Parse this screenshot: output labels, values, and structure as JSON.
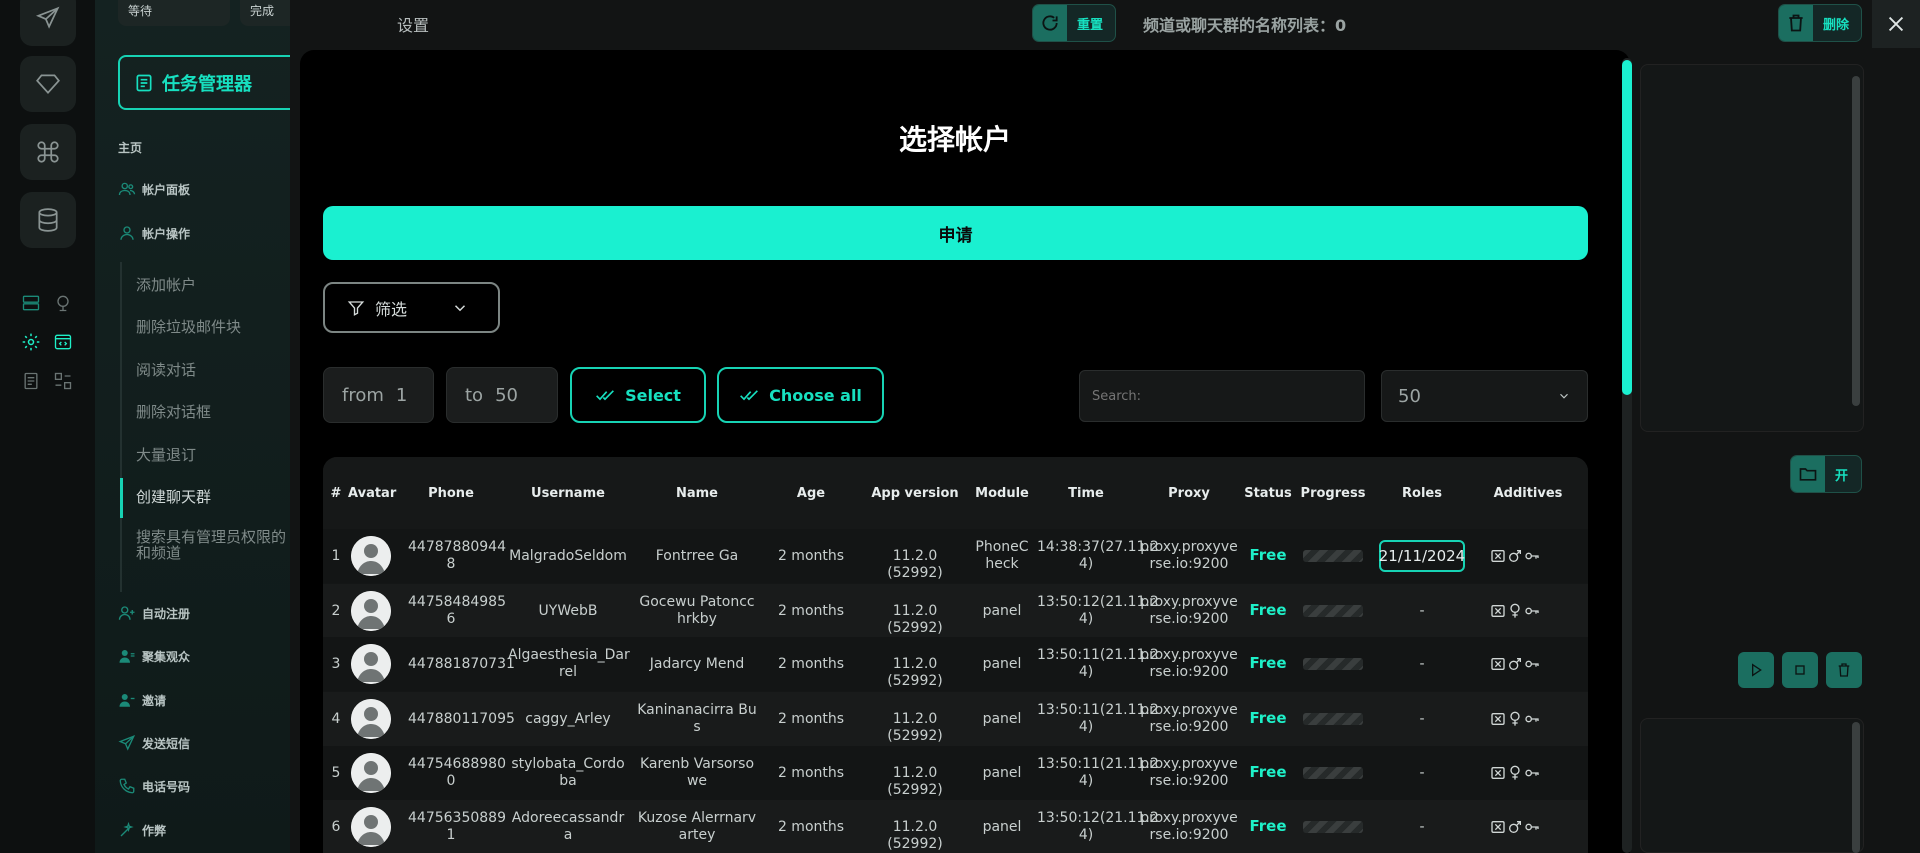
{
  "sidebar_top": {
    "waiting": "等待",
    "done": "完成"
  },
  "sidebar": {
    "task_manager": "任务管理器",
    "home": "主页",
    "account_panel": "帐户面板",
    "account_ops": "帐户操作",
    "sub_items": [
      "添加帐户",
      "删除垃圾邮件块",
      "阅读对话",
      "删除对话框",
      "大量退订",
      "创建聊天群",
      "搜索具有管理员权限的和频道"
    ],
    "sections": [
      "自动注册",
      "聚集观众",
      "邀请",
      "发送短信",
      "电话号码",
      "作弊"
    ]
  },
  "topbar": {
    "settings": "设置",
    "reset": "重置",
    "channel_count": "频道或聊天群的名称列表：0",
    "delete": "删除",
    "open": "开"
  },
  "modal": {
    "title": "选择帐户",
    "apply": "申请",
    "filter": "筛选",
    "from_label": "from",
    "from_value": "1",
    "to_label": "to",
    "to_value": "50",
    "select": "Select",
    "choose_all": "Choose all",
    "search_placeholder": "Search:",
    "per_page": "50"
  },
  "table": {
    "headers": [
      "#",
      "Avatar",
      "Phone",
      "Username",
      "Name",
      "Age",
      "App version",
      "Module",
      "Time",
      "Proxy",
      "Status",
      "Progress",
      "Roles",
      "Additives"
    ],
    "rows": [
      {
        "n": "1",
        "phone": [
          "44787880944",
          "8"
        ],
        "username": [
          "MalgradoSeldom",
          ""
        ],
        "name": [
          "Fontrree Ga",
          ""
        ],
        "age": "2 months",
        "app": "11.2.0 (52992)",
        "module": [
          "PhoneC",
          "heck"
        ],
        "time": [
          "14:38:37(27.11.2",
          "4)"
        ],
        "proxy": [
          "proxy.proxyve",
          "rse.io:9200"
        ],
        "status": "Free",
        "progress": 0,
        "role": "21/11/2024",
        "gender": "male"
      },
      {
        "n": "2",
        "phone": [
          "44758484985",
          "6"
        ],
        "username": [
          "UYWebB",
          ""
        ],
        "name": [
          "Gocewu Patoncc",
          "hrkby"
        ],
        "age": "2 months",
        "app": "11.2.0 (52992)",
        "module": [
          "panel",
          ""
        ],
        "time": [
          "13:50:12(21.11.2",
          "4)"
        ],
        "proxy": [
          "proxy.proxyve",
          "rse.io:9200"
        ],
        "status": "Free",
        "progress": 0,
        "role": "-",
        "gender": "female"
      },
      {
        "n": "3",
        "phone": [
          "447881870731",
          ""
        ],
        "username": [
          "Algaesthesia_Dar",
          "rel"
        ],
        "name": [
          "Jadarcy Mend",
          ""
        ],
        "age": "2 months",
        "app": "11.2.0 (52992)",
        "module": [
          "panel",
          ""
        ],
        "time": [
          "13:50:11(21.11.2",
          "4)"
        ],
        "proxy": [
          "proxy.proxyve",
          "rse.io:9200"
        ],
        "status": "Free",
        "progress": 0,
        "role": "-",
        "gender": "male"
      },
      {
        "n": "4",
        "phone": [
          "447880117095",
          ""
        ],
        "username": [
          "caggy_Arley",
          ""
        ],
        "name": [
          "Kaninanacirra Bu",
          "s"
        ],
        "age": "2 months",
        "app": "11.2.0 (52992)",
        "module": [
          "panel",
          ""
        ],
        "time": [
          "13:50:11(21.11.2",
          "4)"
        ],
        "proxy": [
          "proxy.proxyve",
          "rse.io:9200"
        ],
        "status": "Free",
        "progress": 0,
        "role": "-",
        "gender": "female"
      },
      {
        "n": "5",
        "phone": [
          "44754688980",
          "0"
        ],
        "username": [
          "stylobata_Cordo",
          "ba"
        ],
        "name": [
          "Karenb Varsorso",
          "we"
        ],
        "age": "2 months",
        "app": "11.2.0 (52992)",
        "module": [
          "panel",
          ""
        ],
        "time": [
          "13:50:11(21.11.2",
          "4)"
        ],
        "proxy": [
          "proxy.proxyve",
          "rse.io:9200"
        ],
        "status": "Free",
        "progress": 0,
        "role": "-",
        "gender": "female"
      },
      {
        "n": "6",
        "phone": [
          "44756350889",
          "1"
        ],
        "username": [
          "Adoreecassandr",
          "a"
        ],
        "name": [
          "Kuzose Alerrnarv",
          "artey"
        ],
        "age": "2 months",
        "app": "11.2.0 (52992)",
        "module": [
          "panel",
          ""
        ],
        "time": [
          "13:50:12(21.11.2",
          "4)"
        ],
        "proxy": [
          "proxy.proxyve",
          "rse.io:9200"
        ],
        "status": "Free",
        "progress": 0,
        "role": "-",
        "gender": "male"
      }
    ]
  },
  "colors": {
    "accent": "#1af0d0",
    "accent_dark": "#1b6e60",
    "bg": "#000000"
  }
}
